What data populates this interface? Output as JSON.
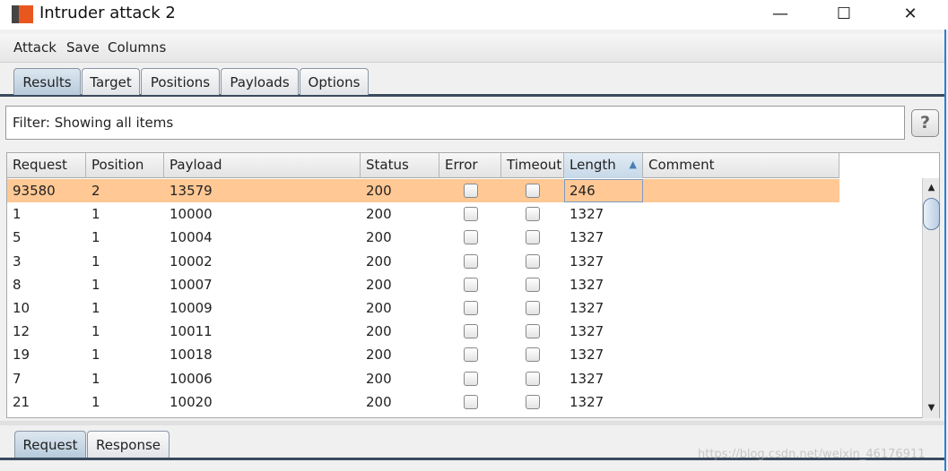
{
  "window": {
    "title": "Intruder attack 2",
    "minimize": "—",
    "maximize": "☐",
    "close": "✕"
  },
  "menu": [
    "Attack",
    "Save",
    "Columns"
  ],
  "tabs": [
    {
      "label": "Results",
      "active": true
    },
    {
      "label": "Target"
    },
    {
      "label": "Positions"
    },
    {
      "label": "Payloads"
    },
    {
      "label": "Options"
    }
  ],
  "filter": {
    "text": "Filter: Showing all items",
    "help": "?"
  },
  "table": {
    "columns": [
      "Request",
      "Position",
      "Payload",
      "Status",
      "Error",
      "Timeout",
      "Length",
      "Comment"
    ],
    "sorted_column": "Length",
    "sort_direction": "ascending",
    "rows": [
      [
        "93580",
        "2",
        "13579",
        "200",
        false,
        false,
        "246",
        ""
      ],
      [
        "1",
        "1",
        "10000",
        "200",
        false,
        false,
        "1327",
        ""
      ],
      [
        "5",
        "1",
        "10004",
        "200",
        false,
        false,
        "1327",
        ""
      ],
      [
        "3",
        "1",
        "10002",
        "200",
        false,
        false,
        "1327",
        ""
      ],
      [
        "8",
        "1",
        "10007",
        "200",
        false,
        false,
        "1327",
        ""
      ],
      [
        "10",
        "1",
        "10009",
        "200",
        false,
        false,
        "1327",
        ""
      ],
      [
        "12",
        "1",
        "10011",
        "200",
        false,
        false,
        "1327",
        ""
      ],
      [
        "19",
        "1",
        "10018",
        "200",
        false,
        false,
        "1327",
        ""
      ],
      [
        "7",
        "1",
        "10006",
        "200",
        false,
        false,
        "1327",
        ""
      ],
      [
        "21",
        "1",
        "10020",
        "200",
        false,
        false,
        "1327",
        ""
      ]
    ],
    "selected_row_color": "#ffc894"
  },
  "bottom_tabs": [
    {
      "label": "Request",
      "active": true
    },
    {
      "label": "Response"
    }
  ],
  "watermark": "https://blog.csdn.net/weixin_46176911"
}
